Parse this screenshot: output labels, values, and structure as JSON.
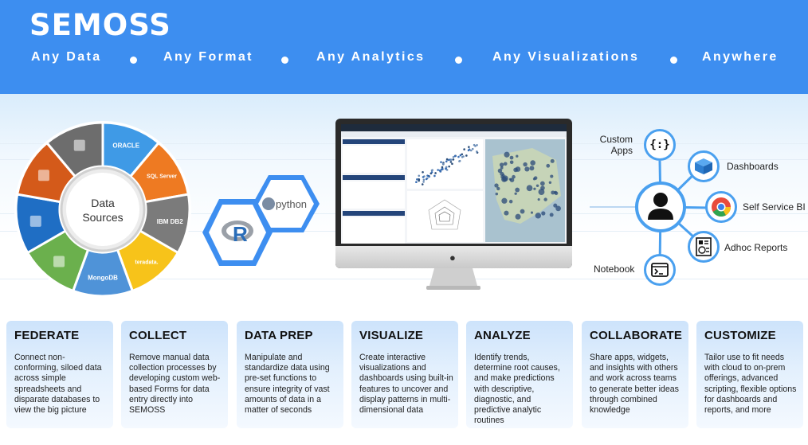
{
  "brand": {
    "name": "SEMOSS"
  },
  "taglines": [
    "Any Data",
    "Any Format",
    "Any Analytics",
    "Any Visualizations",
    "Anywhere"
  ],
  "data_sources": {
    "center_label": "Data Sources",
    "segments": [
      {
        "name": "ORACLE",
        "color": "#3f9ae6"
      },
      {
        "name": "SQL Server",
        "color": "#ee7a22"
      },
      {
        "name": "IBM DB2",
        "color": "#7b7b7b"
      },
      {
        "name": "teradata.",
        "color": "#f7c31a"
      },
      {
        "name": "MongoDB",
        "color": "#4f93d8"
      },
      {
        "name": "file-icon",
        "color": "#6bb04d"
      },
      {
        "name": "cloud-icon",
        "color": "#1f6ec4"
      },
      {
        "name": "excel-icon",
        "color": "#d45a1a"
      },
      {
        "name": "hadoop-icon",
        "color": "#6d6d6d"
      }
    ]
  },
  "languages": {
    "python": "python",
    "r": "R"
  },
  "colors": {
    "header": "#3d8ef0",
    "accent": "#4aa0ef"
  },
  "outputs": {
    "custom_apps": "Custom Apps",
    "dashboards": "Dashboards",
    "self_service_bi": "Self Service BI",
    "adhoc_reports": "Adhoc Reports",
    "notebook": "Notebook"
  },
  "cards": [
    {
      "title": "FEDERATE",
      "body": "Connect non-conforming, siloed data across simple spreadsheets and disparate databases to view the big picture"
    },
    {
      "title": "COLLECT",
      "body": "Remove manual data collection processes by developing custom web-based Forms for data entry directly into SEMOSS"
    },
    {
      "title": "DATA PREP",
      "body": "Manipulate and standardize data using pre-set functions to ensure integrity of vast amounts of data in a matter of seconds"
    },
    {
      "title": "VISUALIZE",
      "body": "Create interactive visualizations and dashboards using built-in features to uncover and display patterns in multi-dimensional data"
    },
    {
      "title": "ANALYZE",
      "body": "Identify trends, determine root causes, and make predictions with descriptive, diagnostic, and predictive analytic routines"
    },
    {
      "title": "COLLABORATE",
      "body": "Share apps, widgets, and insights with others and work across teams to generate better ideas through combined knowledge"
    },
    {
      "title": "CUSTOMIZE",
      "body": "Tailor use to fit needs with cloud to on-prem offerings, advanced scripting, flexible options for dashboards and reports, and more"
    }
  ]
}
